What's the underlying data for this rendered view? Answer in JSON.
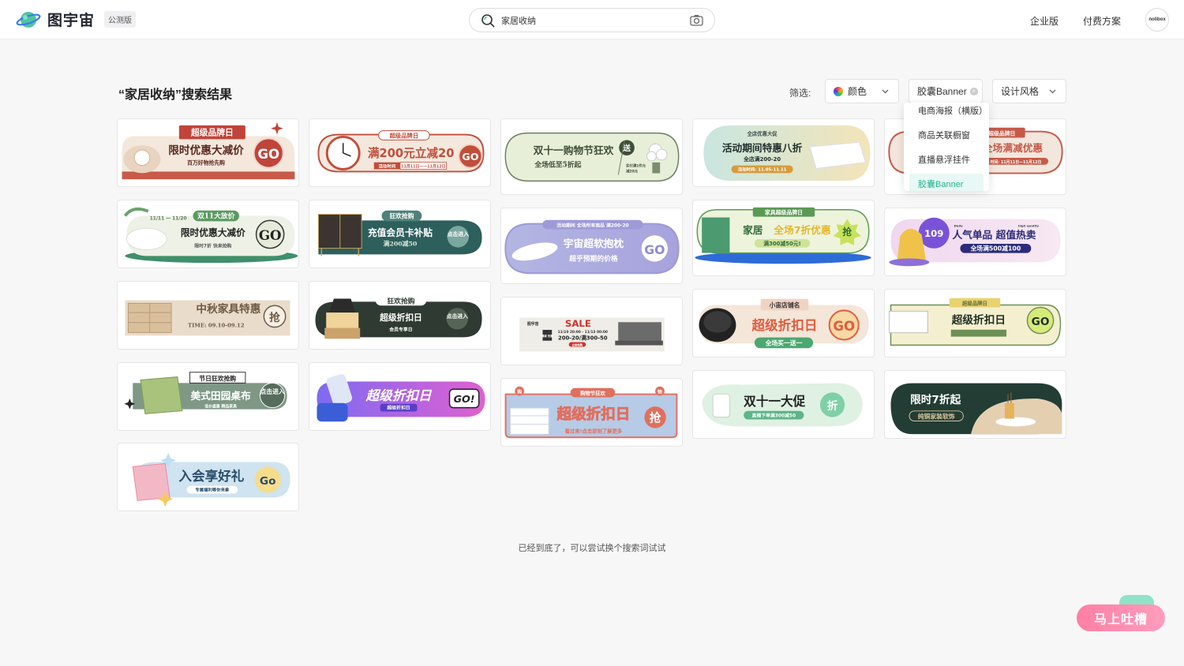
{
  "header": {
    "logo_text": "图宇宙",
    "beta": "公测版",
    "search_value": "家居收纳",
    "nav": [
      "企业版",
      "付费方案"
    ],
    "avatar_text": "nolibox"
  },
  "results": {
    "title": "“家居收纳”搜索结果",
    "filter_label": "筛选:",
    "filters": {
      "color": "颜色",
      "type": "胶囊Banner",
      "style": "设计风格"
    },
    "dropdown": [
      "电商海报（横版）",
      "商品关联橱窗",
      "直播悬浮挂件",
      "胶囊Banner"
    ],
    "end_text": "已经到底了，可以尝试换个搜索词试试"
  },
  "feedback": "马上吐槽",
  "banners": {
    "b1": {
      "top": "超级品牌日",
      "main": "限时优惠大减价",
      "sub": "百万好物抢先购",
      "go": "GO"
    },
    "b2": {
      "top": "超级品牌日",
      "main": "满200元立减20",
      "sub": "活动时间",
      "date": "11月11日——11月12日",
      "go": "GO"
    },
    "b3": {
      "main": "双十一购物节狂欢",
      "sub": "全场低至5折起",
      "badge": "送",
      "side1": "实付满1件元",
      "side2": "减20元"
    },
    "b4": {
      "top": "全店优惠大促",
      "main": "活动期间特惠八折",
      "sub": "全店满200-20",
      "date": "活动时间: 11.05-11.11"
    },
    "b5": {
      "top": "超级品牌日",
      "main": "全场满减优惠",
      "date": "时间: 11月11日—11月12日"
    },
    "b6": {
      "top": "11/11 — 11/20",
      "tag": "双11大放价",
      "main": "限时优惠大减价",
      "sub": "限时7折 快来抢购",
      "go": "GO"
    },
    "b7": {
      "tag": "狂欢抢购",
      "main": "充值会员卡补贴",
      "sub": "满200减50",
      "cta": "点击进入"
    },
    "b8": {
      "top": "活动期间 全场所有商品 满200-20",
      "main": "宇宙超软抱枕",
      "sub": "超乎预期的价格",
      "go": "GO"
    },
    "b9": {
      "top": "家具超级品牌日",
      "main1": "家居",
      "main2": "全场7折优惠",
      "sub": "满300减50元!",
      "badge": "抢"
    },
    "b10": {
      "num": "109",
      "main": "人气单品 超值热卖",
      "sub": "全场满500减100",
      "mini1": "Daily",
      "mini2": "high quality"
    },
    "b11": {
      "main": "中秋家具特惠",
      "sub": "TIME: 09.10-09.12",
      "badge": "抢"
    },
    "b12": {
      "tag": "狂欢抢购",
      "main": "超级折扣日",
      "sub": "会员专享日",
      "cta": "点击进入"
    },
    "b13": {
      "brand": "图宇宙",
      "sale": "SALE",
      "line1": "11/10 20:00 - 11/13 00:00",
      "line2": "200-20/满300-50",
      "btn": "立即抢购",
      "tagtxt": "满减 优惠"
    },
    "b14": {
      "top": "小宙店铺名",
      "main": "超级折扣日",
      "sub": "全场买一送一",
      "go": "GO"
    },
    "b15": {
      "top": "超级品牌日",
      "main": "超级折扣日",
      "go": "GO"
    },
    "b16": {
      "top": "节日狂欢抢购",
      "main": "美式田园桌布",
      "sub": "低价盛惠  精品家具",
      "cta": "点击进入"
    },
    "b17": {
      "main": "超级折扣日",
      "sub": "超级折扣日",
      "go": "GO!"
    },
    "b18": {
      "top": "购物节狂欢",
      "main": "超级折扣日",
      "sub": "看过来!点击即刻了解更多",
      "badge": "抢",
      "l": "购",
      "r": "物"
    },
    "b19": {
      "main": "双十一大促",
      "sub": "直播下单满300减50",
      "badge": "折"
    },
    "b20": {
      "main": "限时7折起",
      "sub": "纯铜家装软饰"
    },
    "b21": {
      "main": "入会享好礼",
      "sub": "专属福利等你来拿",
      "go": "Go"
    }
  }
}
